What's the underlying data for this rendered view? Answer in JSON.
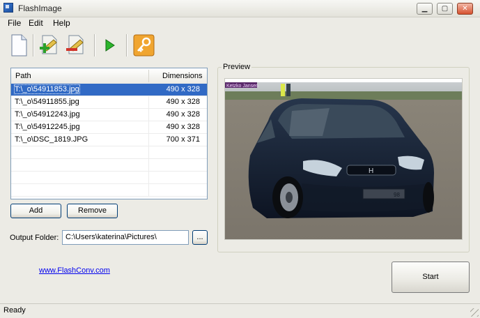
{
  "window": {
    "title": "FlashImage"
  },
  "menu": [
    {
      "label": "File"
    },
    {
      "label": "Edit"
    },
    {
      "label": "Help"
    }
  ],
  "toolbar": {
    "icons": [
      "new-document-icon",
      "add-image-icon",
      "remove-image-icon",
      "play-icon",
      "key-icon"
    ]
  },
  "file_list": {
    "headers": {
      "path": "Path",
      "dimensions": "Dimensions"
    },
    "rows": [
      {
        "path": "T:\\_o\\54911853.jpg",
        "dimensions": "490 x 328",
        "selected": true
      },
      {
        "path": "T:\\_o\\54911855.jpg",
        "dimensions": "490 x 328"
      },
      {
        "path": "T:\\_o\\54912243.jpg",
        "dimensions": "490 x 328"
      },
      {
        "path": "T:\\_o\\54912245.jpg",
        "dimensions": "490 x 328"
      },
      {
        "path": "T:\\_o\\DSC_1819.JPG",
        "dimensions": "700 x 371"
      }
    ]
  },
  "buttons": {
    "add": "Add",
    "remove": "Remove",
    "browse": "...",
    "start": "Start"
  },
  "output": {
    "label": "Output Folder:",
    "value": "C:\\Users\\katerina\\Pictures\\"
  },
  "preview": {
    "label": "Preview",
    "watermark": "Ketzko Jansen",
    "plate": "98"
  },
  "link": {
    "text": "www.FlashConv.com"
  },
  "status": {
    "text": "Ready"
  },
  "colors": {
    "selection": "#316ac5",
    "link": "#0000ee",
    "window_bg": "#ecebe5"
  }
}
